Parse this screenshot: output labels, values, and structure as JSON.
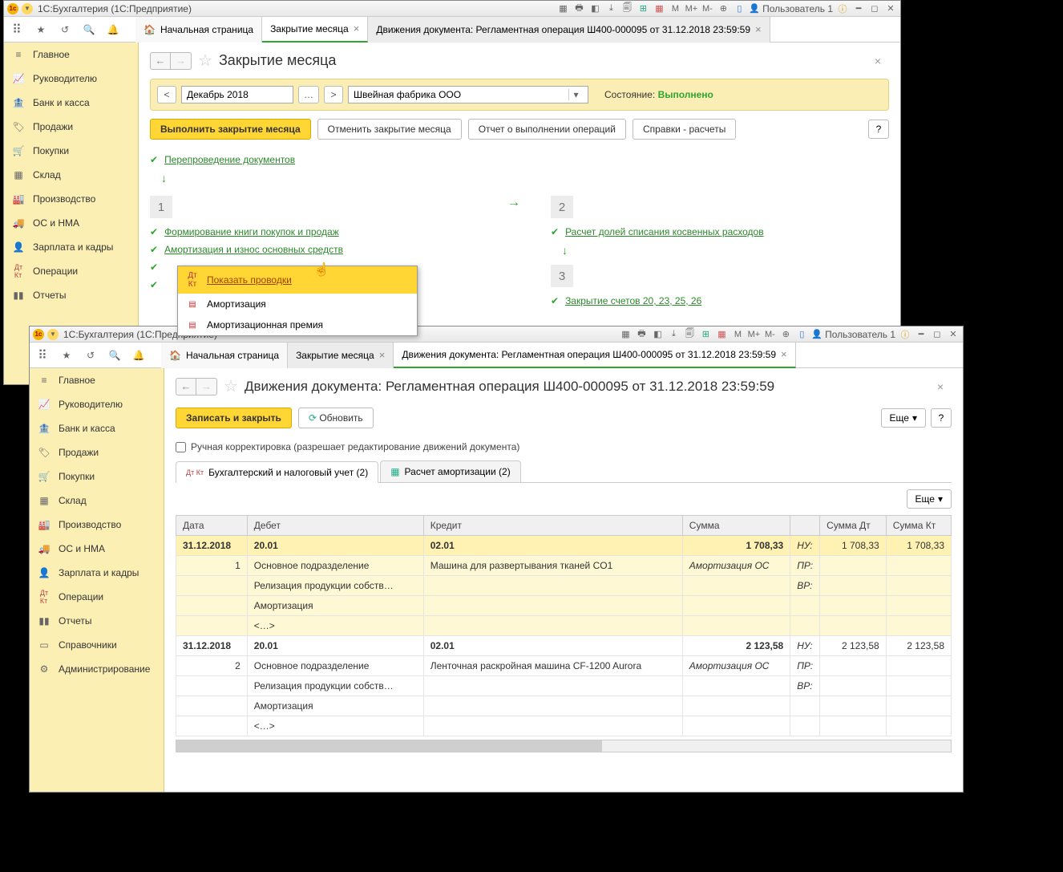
{
  "win1": {
    "title": "1С:Бухгалтерия  (1С:Предприятие)",
    "user": "Пользователь 1",
    "tabs": {
      "home": "Начальная страница",
      "close": "Закрытие месяца",
      "doc": "Движения документа: Регламентная операция Ш400-000095 от 31.12.2018 23:59:59"
    },
    "sidebar": [
      "Главное",
      "Руководителю",
      "Банк и касса",
      "Продажи",
      "Покупки",
      "Склад",
      "Производство",
      "ОС и НМА",
      "Зарплата и кадры",
      "Операции",
      "Отчеты"
    ],
    "page": {
      "title": "Закрытие месяца",
      "period": "Декабрь 2018",
      "org": "Швейная фабрика ООО",
      "status_label": "Состояние:",
      "status_value": "Выполнено",
      "btn_primary": "Выполнить закрытие месяца",
      "btn_cancel": "Отменить закрытие месяца",
      "btn_report": "Отчет о выполнении операций",
      "btn_ref": "Справки - расчеты",
      "op_repost": "Перепроведение документов",
      "stage1": "1",
      "stage2": "2",
      "stage3": "3",
      "op1a": "Формирование книги покупок и продаж",
      "op1b": "Амортизация и износ основных средств",
      "op2a": "Расчет долей списания косвенных расходов",
      "op3a": "Закрытие счетов 20, 23, 25, 26"
    },
    "ctx": {
      "i1": "Показать проводки",
      "i2": "Амортизация",
      "i3": "Амортизационная премия"
    }
  },
  "win2": {
    "title": "1С:Бухгалтерия  (1С:Предприятие)",
    "user": "Пользователь 1",
    "tabs": {
      "home": "Начальная страница",
      "close": "Закрытие месяца",
      "doc": "Движения документа: Регламентная операция Ш400-000095 от 31.12.2018 23:59:59"
    },
    "sidebar": [
      "Главное",
      "Руководителю",
      "Банк и касса",
      "Продажи",
      "Покупки",
      "Склад",
      "Производство",
      "ОС и НМА",
      "Зарплата и кадры",
      "Операции",
      "Отчеты",
      "Справочники",
      "Администрирование"
    ],
    "page": {
      "title": "Движения документа: Регламентная операция Ш400-000095 от 31.12.2018 23:59:59",
      "btn_save": "Записать и закрыть",
      "btn_refresh": "Обновить",
      "btn_more": "Еще",
      "manual_label": "Ручная корректировка (разрешает редактирование движений документа)",
      "tab1": "Бухгалтерский и налоговый учет (2)",
      "tab2": "Расчет амортизации (2)"
    },
    "table": {
      "headers": {
        "date": "Дата",
        "debit": "Дебет",
        "credit": "Кредит",
        "sum": "Сумма",
        "sumdt": "Сумма Дт",
        "sumkt": "Сумма Кт"
      },
      "tags": {
        "nu": "НУ:",
        "pr": "ПР:",
        "vr": "ВР:"
      },
      "rows": [
        {
          "date": "31.12.2018",
          "n": "1",
          "d_acc": "20.01",
          "c_acc": "02.01",
          "sum": "1 708,33",
          "sumdt": "1 708,33",
          "sumkt": "1 708,33",
          "d1": "Основное подразделение",
          "c1": "Машина для развертывания тканей CO1",
          "desc": "Амортизация ОС",
          "d2": "Релизация продукции собств…",
          "d3": "Амортизация",
          "d4": "<…>"
        },
        {
          "date": "31.12.2018",
          "n": "2",
          "d_acc": "20.01",
          "c_acc": "02.01",
          "sum": "2 123,58",
          "sumdt": "2 123,58",
          "sumkt": "2 123,58",
          "d1": "Основное подразделение",
          "c1": "Ленточная раскройная машина CF-1200 Aurora",
          "desc": "Амортизация ОС",
          "d2": "Релизация продукции собств…",
          "d3": "Амортизация",
          "d4": "<…>"
        }
      ]
    }
  }
}
